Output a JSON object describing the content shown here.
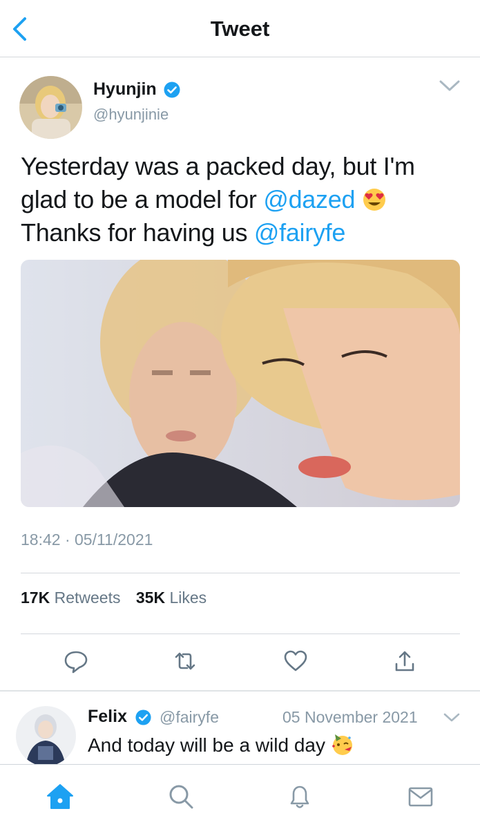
{
  "header": {
    "title": "Tweet",
    "back_icon": "chevron-left-icon"
  },
  "tweet": {
    "author_name": "Hyunjin",
    "author_handle": "@hyunjinie",
    "text_parts": [
      "Yesterday was a packed day, but I'm glad to be a model for ",
      "@dazed",
      " ",
      " Thanks for having us ",
      "@fairyfe"
    ],
    "emoji": "heart-eyes-emoji",
    "timestamp": "18:42 · 05/11/2021",
    "retweets_count": "17K",
    "retweets_label": "Retweets",
    "likes_count": "35K",
    "likes_label": "Likes",
    "actions": [
      "reply-icon",
      "retweet-icon",
      "like-icon",
      "share-icon"
    ]
  },
  "reply": {
    "author_name": "Felix",
    "author_handle": "@fairyfe",
    "date": "05 November 2021",
    "text": "And today will be a wild day",
    "emoji": "partying-face-emoji"
  },
  "tab_bar": {
    "tabs": [
      "home-icon",
      "search-icon",
      "notifications-icon",
      "messages-icon"
    ],
    "active": "home-icon"
  },
  "colors": {
    "accent": "#1da1f2",
    "verified": "#1da1f2",
    "muted": "#8899a6"
  }
}
